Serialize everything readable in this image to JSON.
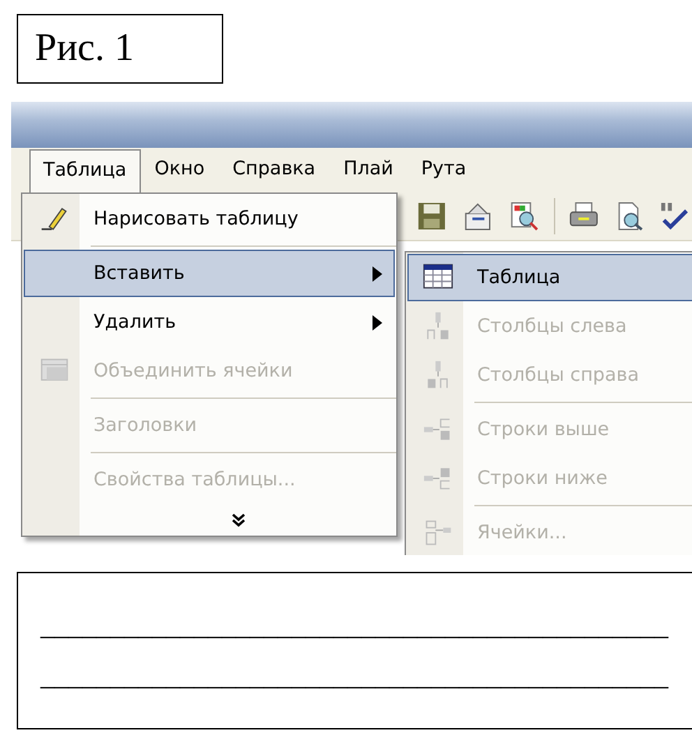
{
  "caption": "Рис. 1",
  "menubar": [
    {
      "label": "Таблица",
      "selected": true
    },
    {
      "label": "Окно",
      "selected": false
    },
    {
      "label": "Справка",
      "selected": false
    },
    {
      "label": "Плай",
      "selected": false
    },
    {
      "label": "Рута",
      "selected": false
    }
  ],
  "menu": {
    "items": [
      {
        "kind": "item",
        "label": "Нарисовать таблицу",
        "selected": false,
        "disabled": false,
        "submenu": false
      },
      {
        "kind": "separator"
      },
      {
        "kind": "item",
        "label": "Вставить",
        "selected": true,
        "disabled": false,
        "submenu": true
      },
      {
        "kind": "item",
        "label": "Удалить",
        "selected": false,
        "disabled": false,
        "submenu": true
      },
      {
        "kind": "item",
        "label": "Объединить ячейки",
        "selected": false,
        "disabled": true,
        "submenu": false
      },
      {
        "kind": "separator"
      },
      {
        "kind": "item",
        "label": "Заголовки",
        "selected": false,
        "disabled": true,
        "submenu": false
      },
      {
        "kind": "separator"
      },
      {
        "kind": "item",
        "label": "Свойства таблицы...",
        "selected": false,
        "disabled": true,
        "submenu": false
      },
      {
        "kind": "more"
      }
    ]
  },
  "submenu": {
    "items": [
      {
        "kind": "item",
        "label": "Таблица",
        "selected": true,
        "disabled": false
      },
      {
        "kind": "item",
        "label": "Столбцы слева",
        "selected": false,
        "disabled": true
      },
      {
        "kind": "item",
        "label": "Столбцы справа",
        "selected": false,
        "disabled": true
      },
      {
        "kind": "separator"
      },
      {
        "kind": "item",
        "label": "Строки выше",
        "selected": false,
        "disabled": true
      },
      {
        "kind": "item",
        "label": "Строки ниже",
        "selected": false,
        "disabled": true
      },
      {
        "kind": "separator"
      },
      {
        "kind": "item",
        "label": "Ячейки...",
        "selected": false,
        "disabled": true
      }
    ]
  },
  "answer_lines": [
    "_____________________________________________",
    "_____________________________________________"
  ]
}
